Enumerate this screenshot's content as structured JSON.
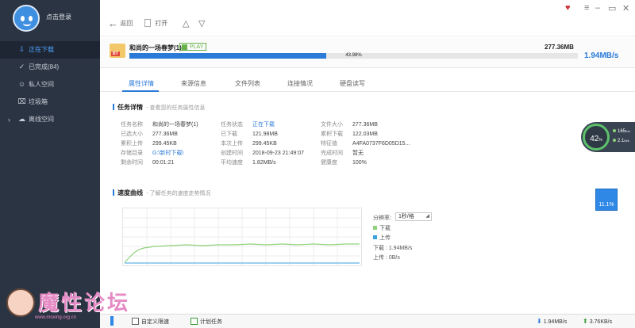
{
  "sidebar": {
    "login_label": "点击登录",
    "items": [
      {
        "label": "正在下载",
        "icon": "download-icon"
      },
      {
        "label": "已完成(84)",
        "icon": "check-circle-icon"
      },
      {
        "label": "私人空间",
        "icon": "user-icon"
      },
      {
        "label": "垃圾箱",
        "icon": "trash-icon"
      },
      {
        "label": "离线空间",
        "icon": "cloud-icon"
      }
    ]
  },
  "toolbar": {
    "back_label": "返回",
    "open_label": "打开"
  },
  "task": {
    "name": "和尚的一场春梦(1)",
    "badge": "PLAY",
    "type_badge": "BT",
    "size": "277.36MB",
    "progress_percent": "43.98%",
    "progress_fraction": 0.4398,
    "speed": "1.94MB/s"
  },
  "tabs": [
    "属性详情",
    "来源信息",
    "文件列表",
    "连接情况",
    "硬盘读写"
  ],
  "details": {
    "title": "任务详情",
    "desc": "- 查看您的任务属性信息",
    "col1": [
      {
        "k": "任务名称",
        "v": "和尚的一场春梦(1)"
      },
      {
        "k": "已选大小",
        "v": "277.36MB"
      },
      {
        "k": "累积上传",
        "v": "299.45KB"
      },
      {
        "k": "存储目录",
        "v": "G:\\新时下载\\"
      },
      {
        "k": "剩余时间",
        "v": "00:01:21"
      }
    ],
    "col2": [
      {
        "k": "任务状态",
        "v": "正在下载"
      },
      {
        "k": "已下载",
        "v": "121.98MB"
      },
      {
        "k": "本次上传",
        "v": "299.45KB"
      },
      {
        "k": "创建时间",
        "v": "2018-09-23 21:49:07"
      },
      {
        "k": "平均速度",
        "v": "1.82MB/s"
      }
    ],
    "col3": [
      {
        "k": "文件大小",
        "v": "277.36MB"
      },
      {
        "k": "累积下载",
        "v": "122.03MB"
      },
      {
        "k": "特征值",
        "v": "A4FA0737F6D05D15..."
      },
      {
        "k": "完成时间",
        "v": "暂无"
      },
      {
        "k": "健康度",
        "v": "100%"
      }
    ]
  },
  "speed_curve": {
    "title": "速度曲线",
    "desc": "- 了解任务的速度走势情况",
    "resolution_label": "分辨率:",
    "resolution_value": "1秒/格",
    "legend_download": "下载",
    "legend_upload": "上传",
    "download_text": "下载 : 1.94MB/s",
    "upload_text": "上传 : 0B/s",
    "download_color": "#8fd27a",
    "upload_color": "#3aa0e0"
  },
  "monitor": {
    "cpu": "42",
    "cpu_unit": "%",
    "up_speed": "165",
    "up_unit": "K/s",
    "down_speed": "2.1",
    "down_unit": "M/s",
    "memory": "11.1%"
  },
  "statusbar": {
    "custom_speed": "自定义限速",
    "schedule": "计划任务",
    "down_speed": "1.94MB/s",
    "up_speed": "3.76KB/s"
  },
  "watermark": {
    "text": "魔性论坛",
    "url": "www.moxing.org.cn"
  }
}
